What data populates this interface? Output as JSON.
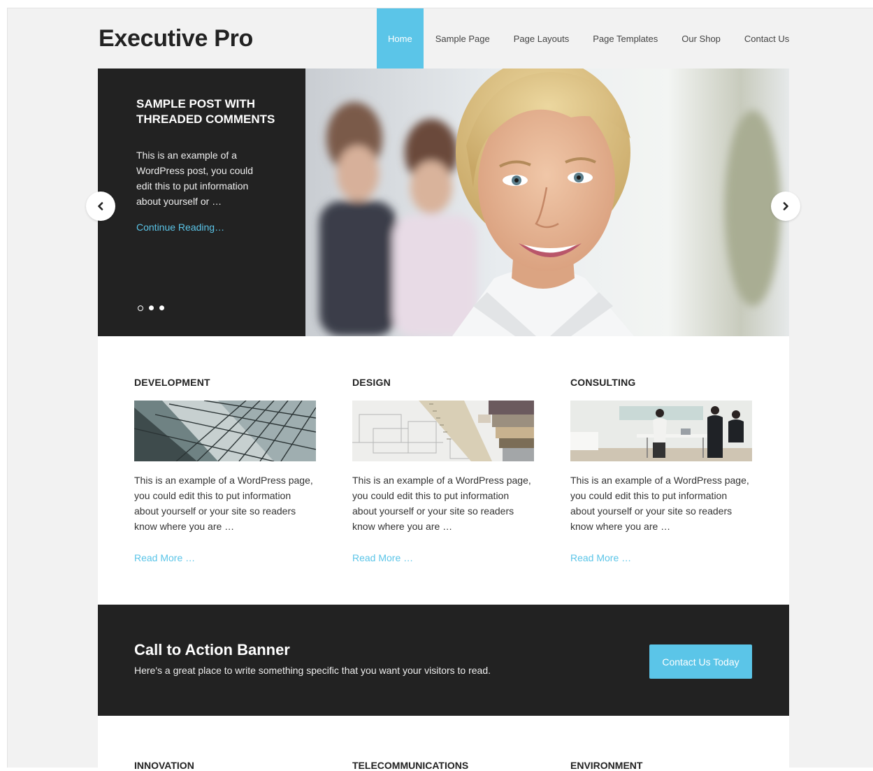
{
  "header": {
    "site_title": "Executive Pro",
    "nav": [
      "Home",
      "Sample Page",
      "Page Layouts",
      "Page Templates",
      "Our Shop",
      "Contact Us"
    ],
    "active_nav": "Home"
  },
  "slider": {
    "title": "SAMPLE POST WITH THREADED COMMENTS",
    "excerpt": "This is an example of a WordPress post, you could edit this to put information about yourself or …",
    "more_link": "Continue Reading…",
    "slide_count": 3,
    "active_slide": 1
  },
  "features": [
    {
      "title": "DEVELOPMENT",
      "text": "This is an example of a WordPress page, you could edit this to put information about yourself or your site so readers know where you are …",
      "more": "Read More …"
    },
    {
      "title": "DESIGN",
      "text": "This is an example of a WordPress page, you could edit this to put information about yourself or your site so readers know where you are …",
      "more": "Read More …"
    },
    {
      "title": "CONSULTING",
      "text": "This is an example of a WordPress page, you could edit this to put information about yourself or your site so readers know where you are …",
      "more": "Read More …"
    }
  ],
  "cta": {
    "title": "Call to Action Banner",
    "text": "Here's a great place to write something specific that you want your visitors to read.",
    "button": "Contact Us Today"
  },
  "bottom_sections": [
    "INNOVATION",
    "TELECOMMUNICATIONS",
    "ENVIRONMENT"
  ],
  "colors": {
    "accent": "#5bc5e8",
    "dark": "#222222",
    "page_bg": "#f2f2f2"
  }
}
